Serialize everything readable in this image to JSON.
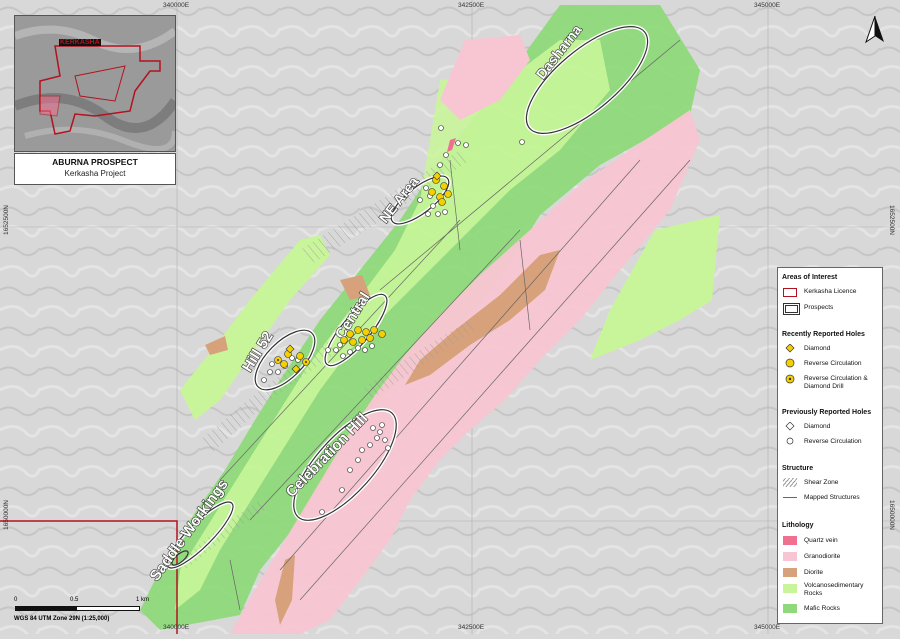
{
  "map": {
    "coords_top": [
      "340000E",
      "342500E",
      "345000E"
    ],
    "coords_bottom": [
      "340000E",
      "342500E",
      "345000E"
    ],
    "coords_left": [
      "1652500N",
      "1652500N",
      "1650000N"
    ],
    "coords_right": [
      "1652500N",
      "1650000N"
    ]
  },
  "inset": {
    "licence_label": "KERKASHA"
  },
  "title_box": {
    "title": "ABURNA PROSPECT",
    "subtitle": "Kerkasha Project"
  },
  "prospects": [
    "Dasharna",
    "NE Area",
    "Central",
    "Hill 52",
    "Celebration Hill",
    "Saddle Workings"
  ],
  "legend": {
    "areas_heading": "Areas of Interest",
    "areas": [
      "Kerkasha Licence",
      "Prospects"
    ],
    "recent_heading": "Recently Reported Holes",
    "recent": [
      "Diamond",
      "Reverse Circulation",
      "Reverse Circulation & Diamond Drill"
    ],
    "previous_heading": "Previously Reported Holes",
    "previous": [
      "Diamond",
      "Reverse Circulation"
    ],
    "structure_heading": "Structure",
    "structure": [
      "Shear Zone",
      "Mapped Structures"
    ],
    "lithology_heading": "Lithology",
    "lithology": [
      {
        "label": "Quartz vein",
        "color": "#f07090"
      },
      {
        "label": "Granodiorite",
        "color": "#f7c6d2"
      },
      {
        "label": "Diorite",
        "color": "#d7a27b"
      },
      {
        "label": "Volcanosedimentary Rocks",
        "color": "#c9f59a"
      },
      {
        "label": "Mafic Rocks",
        "color": "#8fd97a"
      }
    ]
  },
  "scale": {
    "ticks": [
      "0",
      "0.5",
      "1 km"
    ],
    "crs": "WGS 84 UTM Zone 29N (1:25,000)"
  },
  "colors": {
    "licence": "#b3121e",
    "hole_yellow": "#f5d000",
    "background": "#d6d6d6"
  }
}
